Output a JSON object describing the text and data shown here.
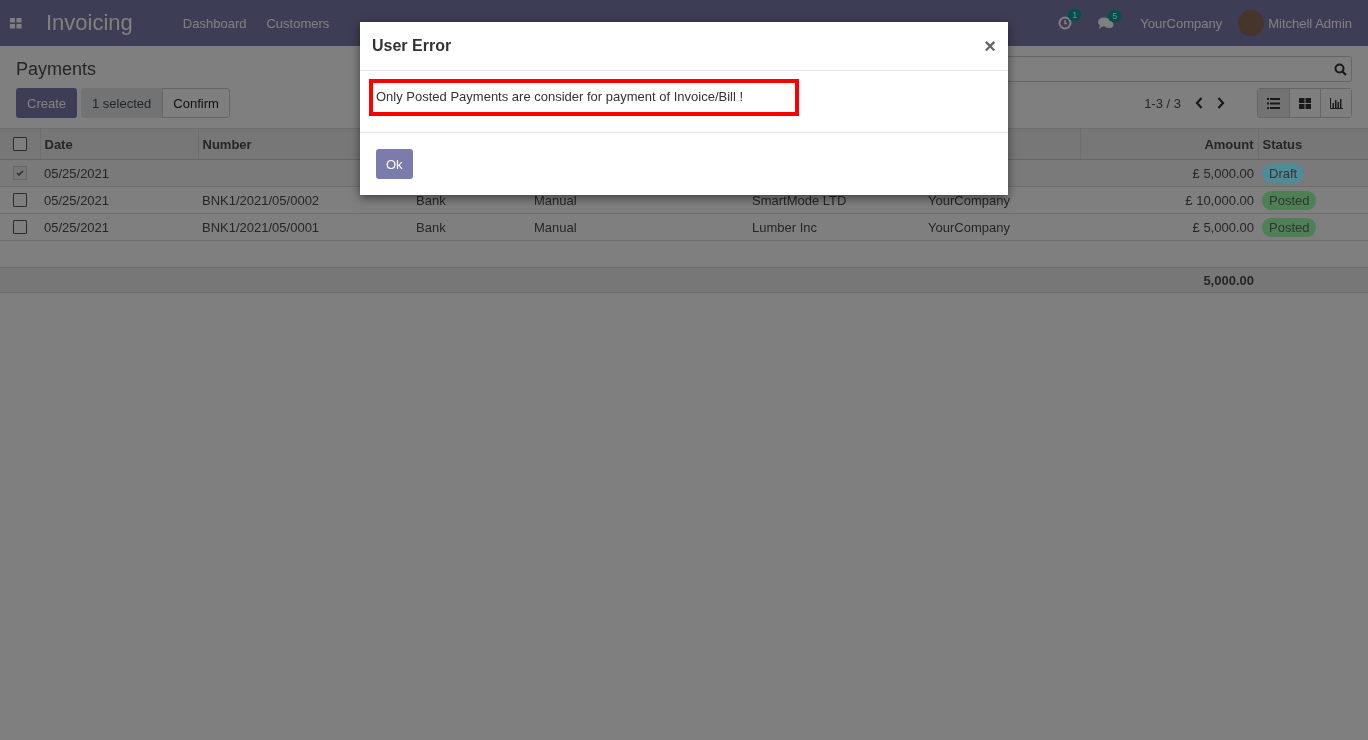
{
  "navbar": {
    "app_name": "Invoicing",
    "menu": [
      "Dashboard",
      "Customers"
    ],
    "activity_count": "1",
    "message_count": "5",
    "company": "YourCompany",
    "user": "Mitchell Admin"
  },
  "control_panel": {
    "title": "Payments",
    "buttons": [
      {
        "label": "Create",
        "kind": "primary"
      },
      {
        "label": "1 selected",
        "kind": "info"
      },
      {
        "label": "Confirm",
        "kind": "secondary"
      }
    ],
    "pager": "1-3 / 3",
    "views": [
      {
        "kind": "list",
        "selected": true
      },
      {
        "kind": "kanban",
        "selected": false
      },
      {
        "kind": "graph",
        "selected": false
      }
    ]
  },
  "table": {
    "all_selected": false,
    "columns": [
      "Date",
      "Number",
      null,
      null,
      null,
      null,
      "Amount",
      "Status"
    ],
    "rows": [
      {
        "selected": true,
        "cells": [
          "05/25/2021",
          null,
          null,
          null,
          null,
          null,
          "£ 5,000.00"
        ],
        "status": {
          "label": "Draft",
          "color": "#4f8c97"
        }
      },
      {
        "selected": false,
        "cells": [
          "05/25/2021",
          "BNK1/2021/05/0002",
          "Bank",
          "Manual",
          "SmartMode LTD",
          "YourCompany",
          "£ 10,000.00"
        ],
        "status": {
          "label": "Posted",
          "color": "#4e8055"
        }
      },
      {
        "selected": false,
        "cells": [
          "05/25/2021",
          "BNK1/2021/05/0001",
          "Bank",
          "Manual",
          "Lumber Inc",
          "YourCompany",
          "£ 5,000.00"
        ],
        "status": {
          "label": "Posted",
          "color": "#4e8055"
        }
      }
    ],
    "total": "5,000.00"
  },
  "dialog": {
    "title": "User Error",
    "close": "×",
    "message": "Only Posted Payments are consider for payment of Invoice/Bill !",
    "button": "Ok"
  }
}
